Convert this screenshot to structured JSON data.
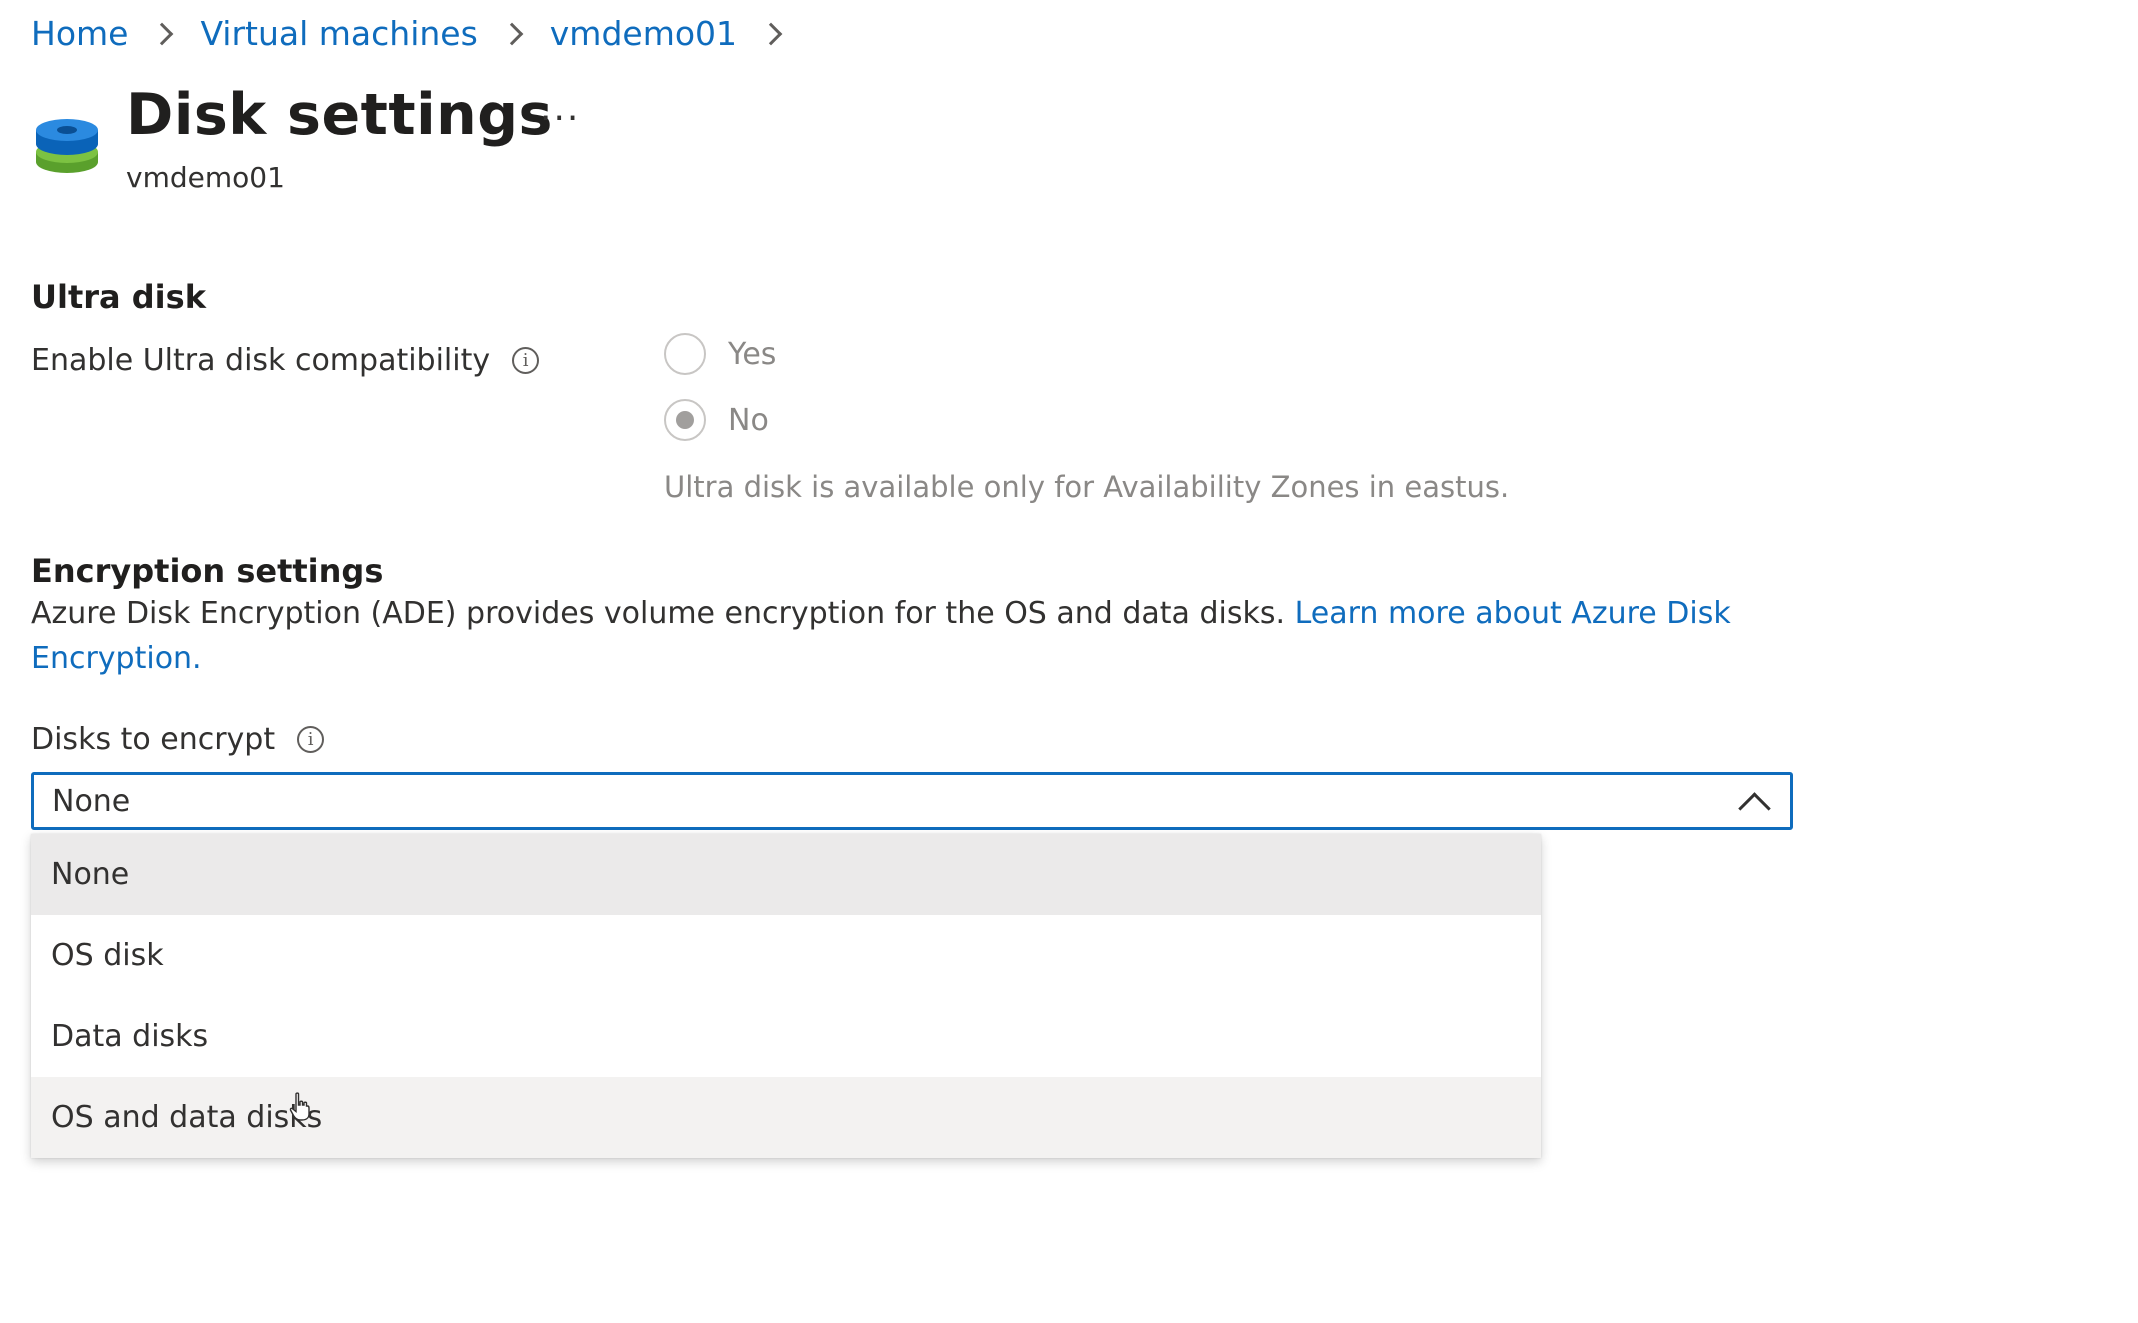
{
  "breadcrumb": [
    "Home",
    "Virtual machines",
    "vmdemo01"
  ],
  "header": {
    "title": "Disk settings",
    "more_label": "···",
    "subtitle": "vmdemo01"
  },
  "ultra_disk": {
    "heading": "Ultra disk",
    "label": "Enable Ultra disk compatibility",
    "info_glyph": "i",
    "options": [
      {
        "label": "Yes",
        "checked": false
      },
      {
        "label": "No",
        "checked": true
      }
    ],
    "note": "Ultra disk is available only for Availability Zones in eastus."
  },
  "encryption": {
    "heading": "Encryption settings",
    "description": "Azure Disk Encryption (ADE) provides volume encryption for the OS and data disks.",
    "link": "Learn more about Azure Disk Encryption.",
    "field_label": "Disks to encrypt",
    "info_glyph": "i",
    "selected_value": "None",
    "options": [
      "None",
      "OS disk",
      "Data disks",
      "OS and data disks"
    ]
  },
  "colors": {
    "accent": "#0f6cbd",
    "selected_bg": "#ebeaea",
    "hover_bg": "#f3f2f1"
  },
  "icons": {
    "page": "disk-stack-icon",
    "cursor": "hand-pointer-icon"
  }
}
